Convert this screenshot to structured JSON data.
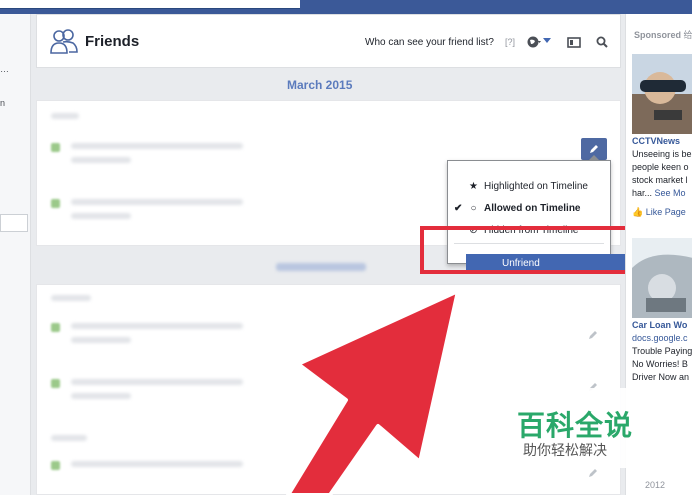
{
  "header": {
    "title": "Friends",
    "privacy_question": "Who can see your friend list?",
    "help_marker": "[?]"
  },
  "timeline": {
    "month_label": "March 2015"
  },
  "visibility_menu": {
    "items": [
      {
        "label": "Highlighted on Timeline",
        "icon": "star-icon"
      },
      {
        "label": "Allowed on Timeline",
        "icon": "circle-icon",
        "checked": true
      },
      {
        "label": "Hidden from Timeline",
        "icon": "block-icon"
      }
    ],
    "unfriend_label": "Unfriend"
  },
  "right_rail": {
    "sponsored_label": "Sponsored",
    "sponsored_extra": "给",
    "ad1": {
      "title": "CCTVNews",
      "lines": [
        "Unseeing is be",
        "people keen o",
        "stock market l",
        "har..."
      ],
      "see_more": "See Mo",
      "like_page": "Like Page"
    },
    "ad2": {
      "title": "Car Loan Wo",
      "domain": "docs.google.c",
      "lines": [
        "Trouble Paying",
        "No Worries! B",
        "Driver Now an"
      ]
    },
    "year": "2012"
  },
  "watermark": {
    "main": "百科全说",
    "sub": "助你轻松解决"
  },
  "colors": {
    "fb_blue": "#3b5998",
    "unfriend_bg": "#4267b2",
    "highlight_red": "#e32d3c",
    "watermark_green": "#2aa86a"
  }
}
